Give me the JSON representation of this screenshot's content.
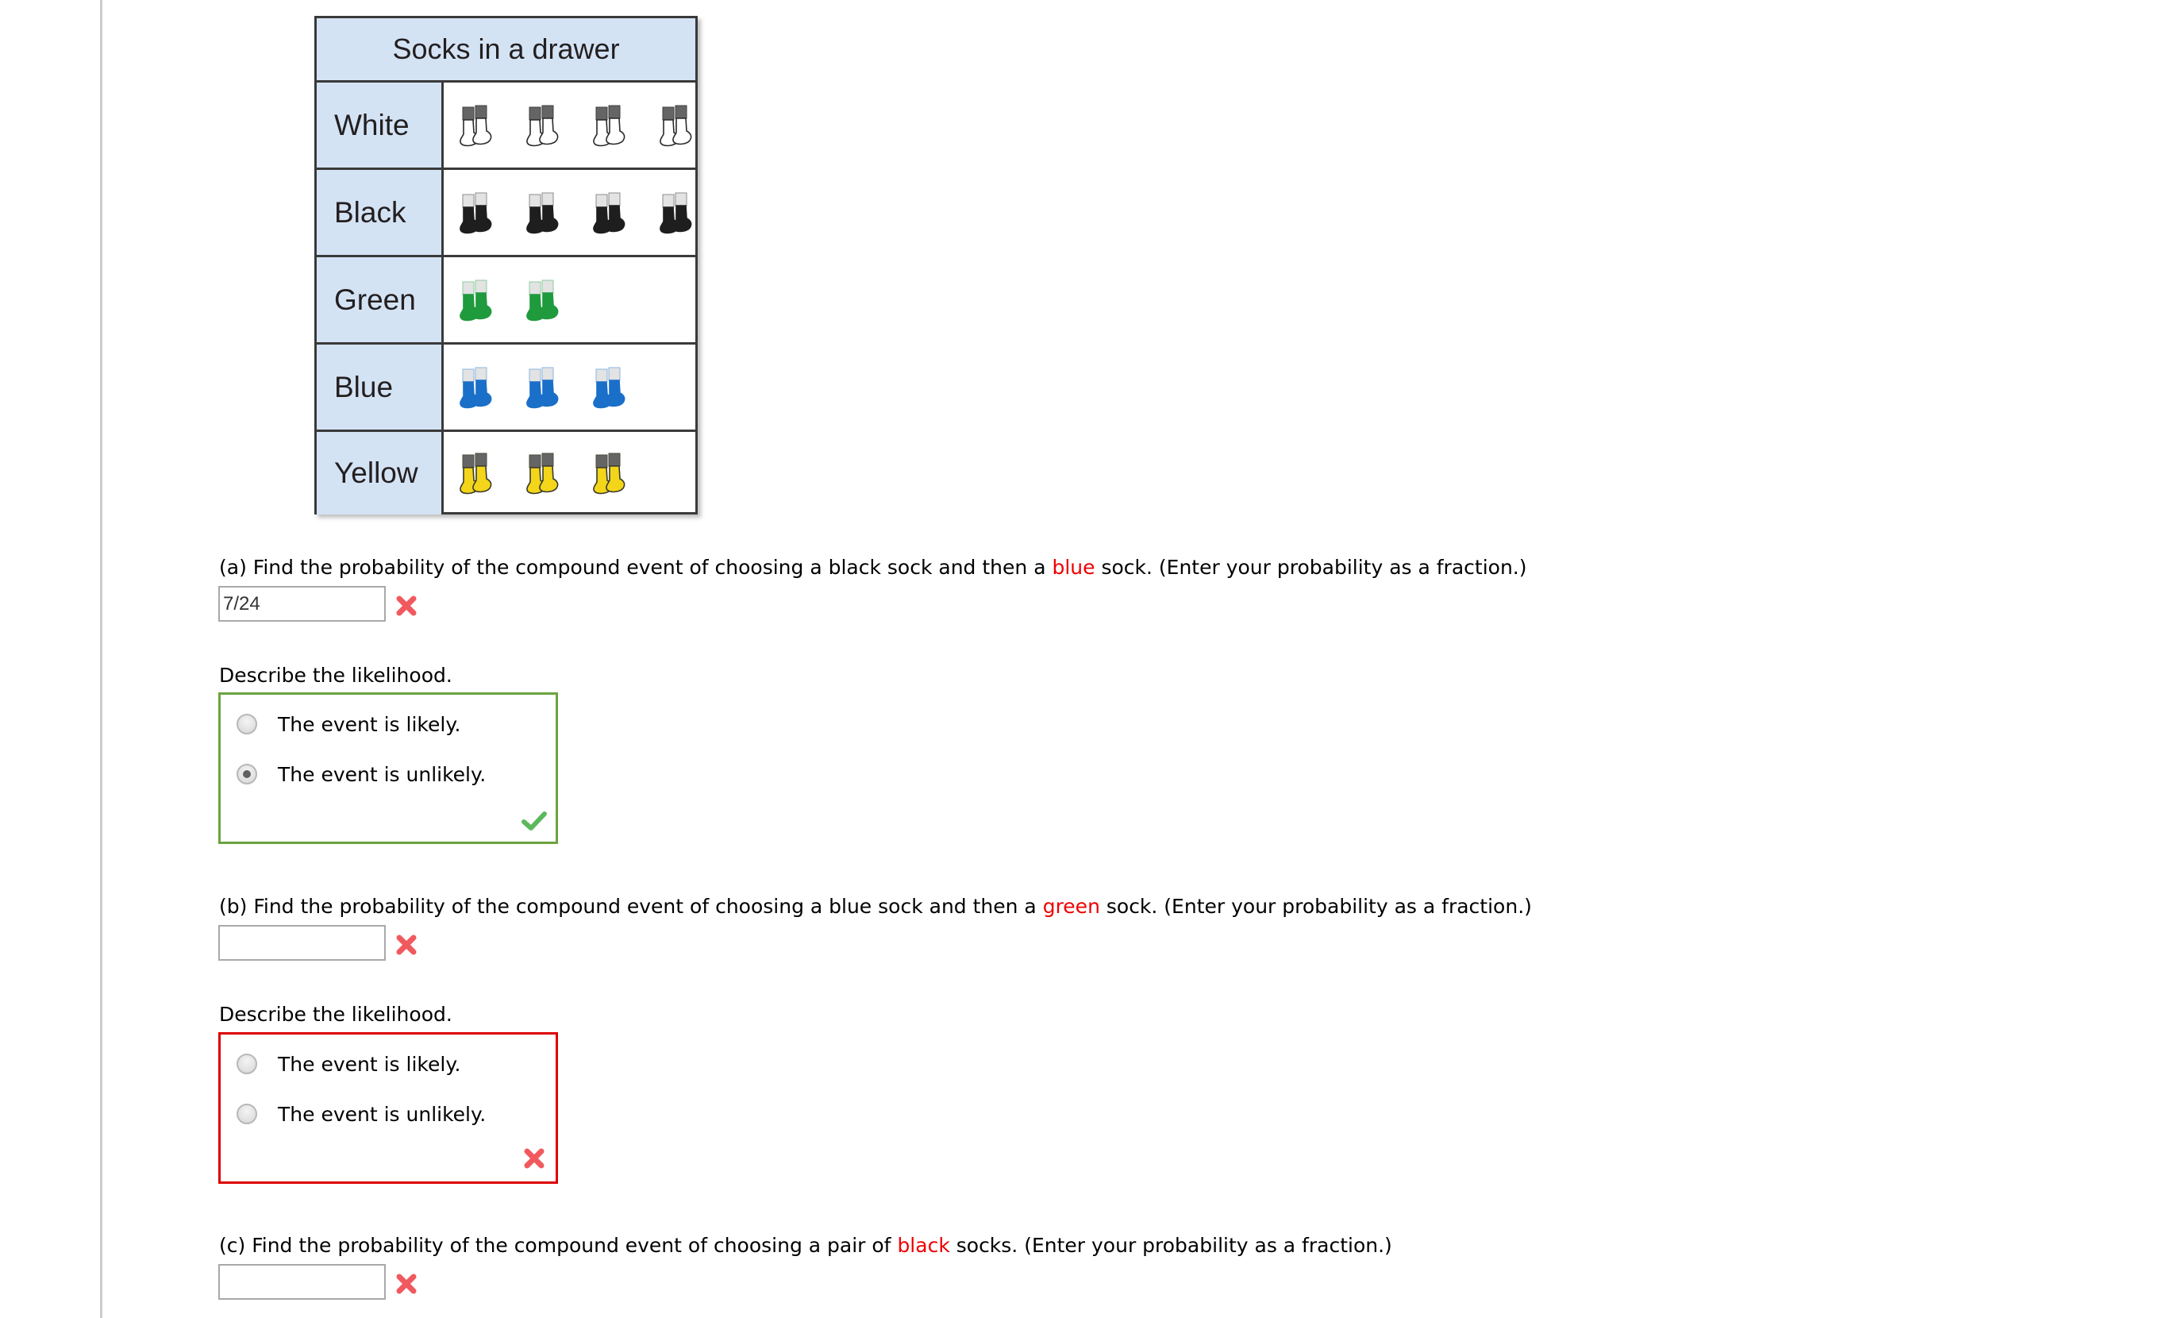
{
  "pictograph": {
    "title": "Socks in a drawer",
    "rows": [
      {
        "label": "White",
        "count": 4,
        "color": "#ffffff",
        "stroke": "#2a2a2a"
      },
      {
        "label": "Black",
        "count": 4,
        "color": "#1e1e1e",
        "stroke": "#1e1e1e"
      },
      {
        "label": "Green",
        "count": 2,
        "color": "#1f9a3c",
        "stroke": "#1f9a3c"
      },
      {
        "label": "Blue",
        "count": 3,
        "color": "#1a6fc9",
        "stroke": "#1a6fc9"
      },
      {
        "label": "Yellow",
        "count": 3,
        "color": "#f3d51a",
        "stroke": "#3a3a2a"
      }
    ]
  },
  "questions": {
    "a": {
      "prefix": "(a) Find the probability of the compound event of choosing a black sock and then a ",
      "highlight": "blue",
      "suffix": " sock. (Enter your probability as a fraction.)",
      "answer_value": "7/24",
      "answer_status": "incorrect",
      "likelihood_label": "Describe the likelihood.",
      "options": [
        "The event is likely.",
        "The event is unlikely."
      ],
      "selected_option": 1,
      "likelihood_status": "correct"
    },
    "b": {
      "prefix": "(b) Find the probability of the compound event of choosing a blue sock and then a ",
      "highlight": "green",
      "suffix": " sock. (Enter your probability as a fraction.)",
      "answer_value": "",
      "answer_status": "incorrect",
      "likelihood_label": "Describe the likelihood.",
      "options": [
        "The event is likely.",
        "The event is unlikely."
      ],
      "selected_option": null,
      "likelihood_status": "incorrect"
    },
    "c": {
      "prefix": "(c) Find the probability of the compound event of choosing a pair of ",
      "highlight": "black",
      "suffix": " socks. (Enter your probability as a fraction.)",
      "answer_value": "",
      "answer_status": "incorrect"
    }
  },
  "colors": {
    "highlight": "#ee0000",
    "correct": "#6ca33f",
    "incorrect": "#dd0000",
    "table_header_bg": "#d4e3f4"
  },
  "icons": {
    "incorrect": "x-mark-icon",
    "correct": "check-mark-icon",
    "sock": "sock-pair-icon"
  }
}
